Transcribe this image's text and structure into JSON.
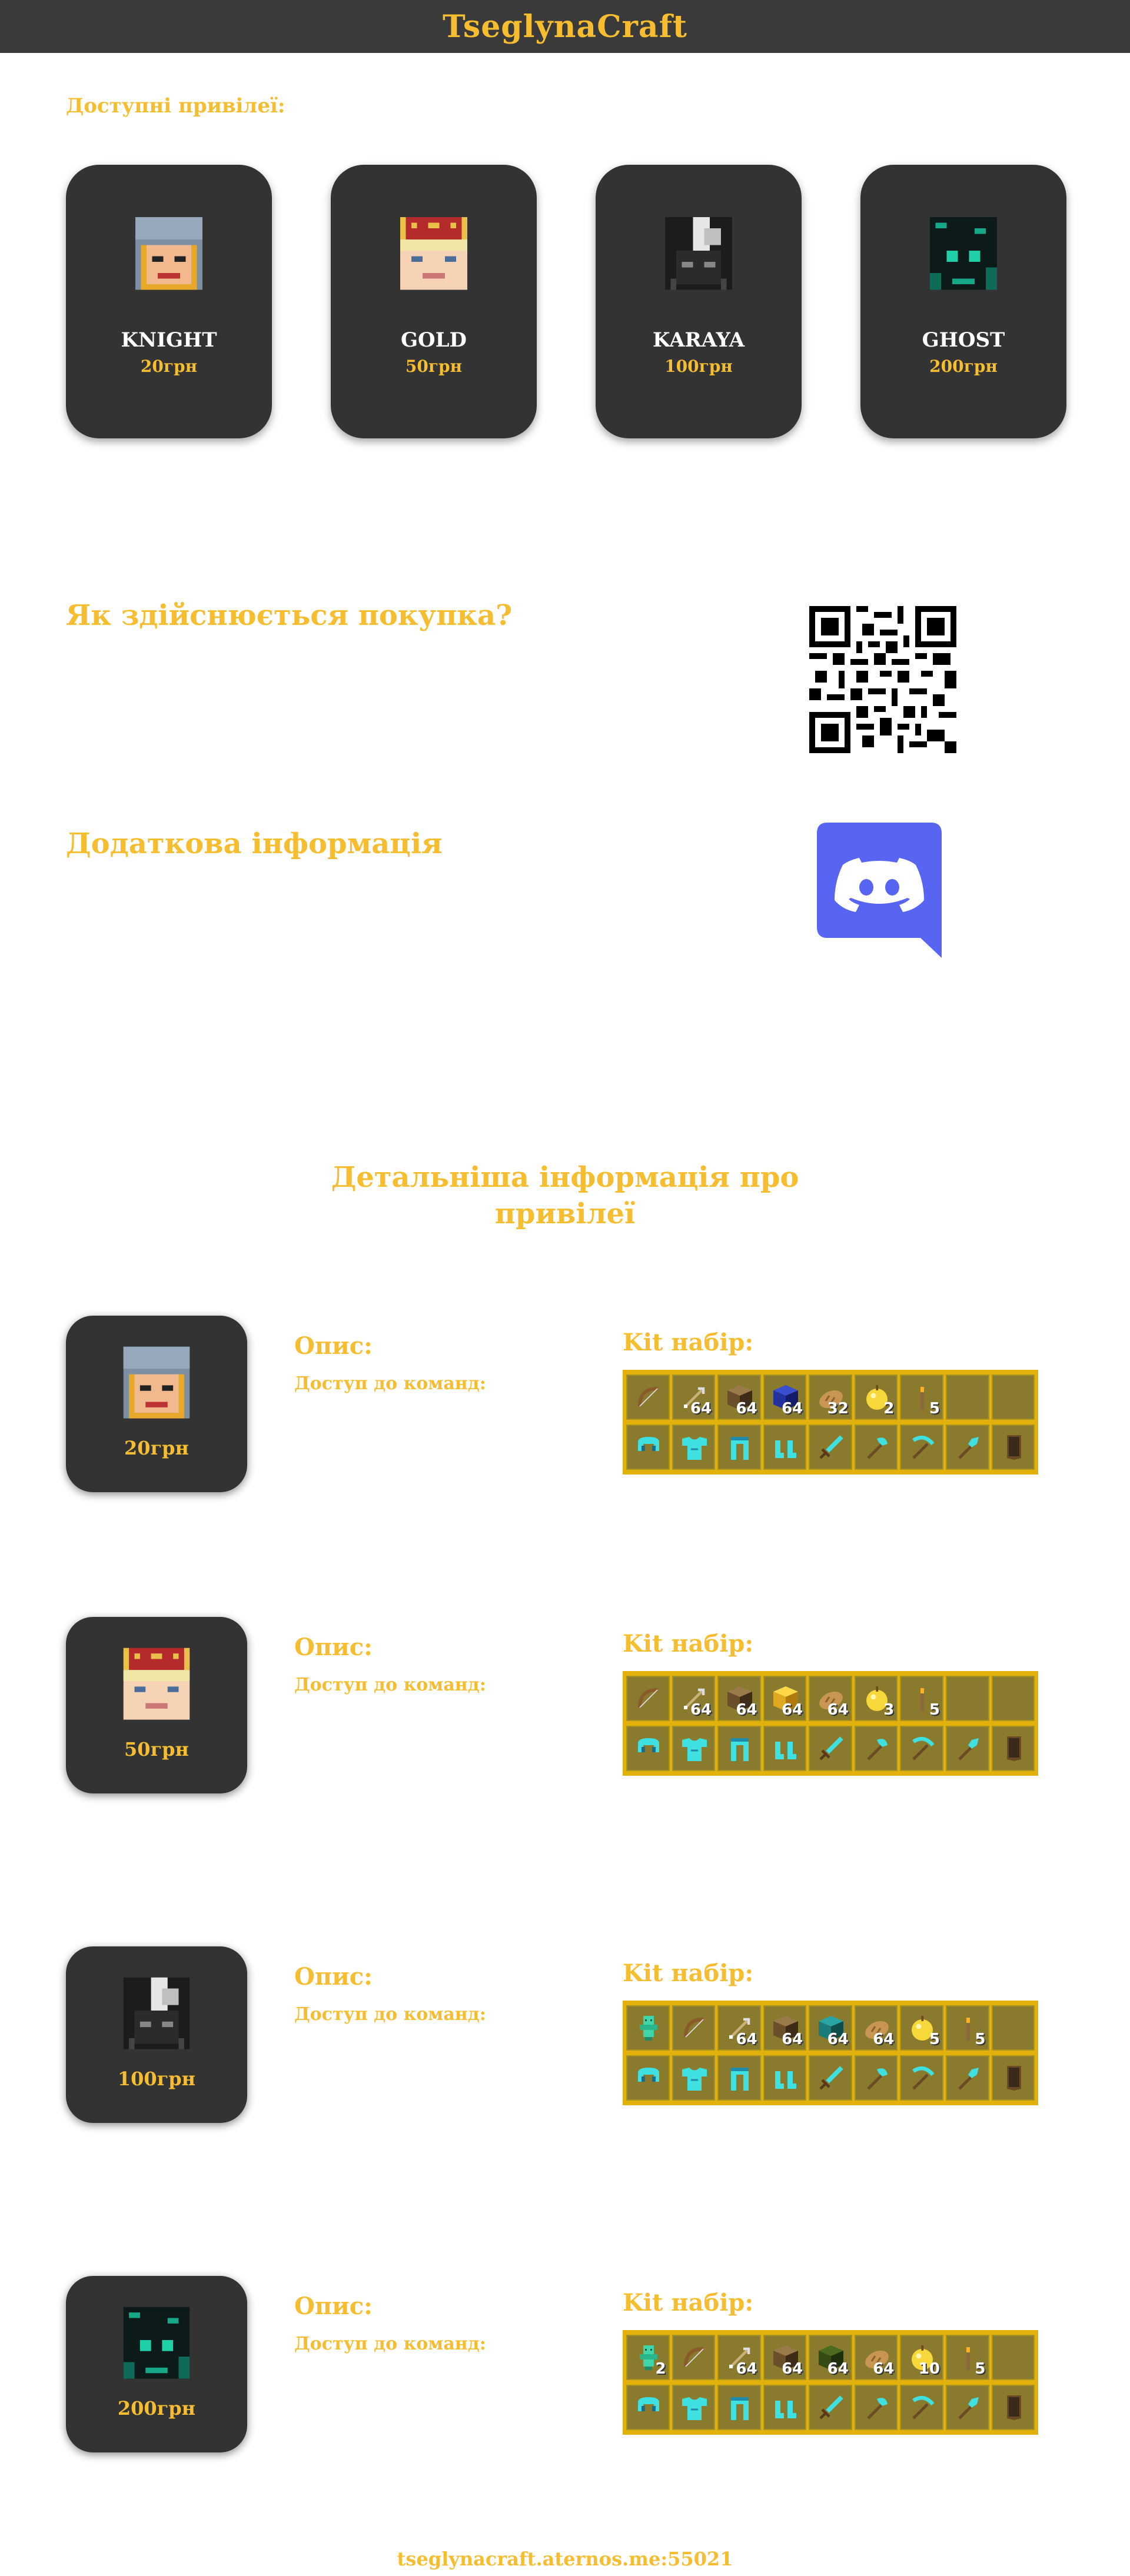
{
  "header": {
    "title": "TseglynaCraft"
  },
  "available": {
    "label": "Доступні привілеї:"
  },
  "privileges": [
    {
      "name": "KNIGHT",
      "price": "20грн",
      "head": "knight"
    },
    {
      "name": "GOLD",
      "price": "50грн",
      "head": "gold"
    },
    {
      "name": "KARAYA",
      "price": "100грн",
      "head": "karaya"
    },
    {
      "name": "GHOST",
      "price": "200грн",
      "head": "ghost"
    }
  ],
  "purchase": {
    "heading": "Як здійснюється покупка?"
  },
  "extra": {
    "heading": "Додаткова інформація"
  },
  "details": {
    "title_line1": "Детальніша інформація про",
    "title_line2": "привілеї",
    "desc_label": "Опис:",
    "cmd_label": "Доступ до команд:",
    "kit_label": "Kit набір:",
    "items": [
      {
        "price": "20грн",
        "row1": [
          {
            "icon": "bow",
            "count": ""
          },
          {
            "icon": "arrow",
            "count": "64"
          },
          {
            "icon": "wood-block",
            "count": "64"
          },
          {
            "icon": "lapis-block",
            "count": "64"
          },
          {
            "icon": "bread",
            "count": "32"
          },
          {
            "icon": "golden-apple",
            "count": "2"
          },
          {
            "icon": "torch",
            "count": "5"
          },
          {
            "icon": "empty",
            "count": ""
          },
          {
            "icon": "empty",
            "count": ""
          }
        ]
      },
      {
        "price": "50грн",
        "row1": [
          {
            "icon": "bow",
            "count": ""
          },
          {
            "icon": "arrow",
            "count": "64"
          },
          {
            "icon": "wood-block",
            "count": "64"
          },
          {
            "icon": "gold-block",
            "count": "64"
          },
          {
            "icon": "bread",
            "count": "64"
          },
          {
            "icon": "golden-apple",
            "count": "3"
          },
          {
            "icon": "torch",
            "count": "5"
          },
          {
            "icon": "empty",
            "count": ""
          },
          {
            "icon": "empty",
            "count": ""
          }
        ]
      },
      {
        "price": "100грн",
        "row1": [
          {
            "icon": "totem",
            "count": ""
          },
          {
            "icon": "bow",
            "count": ""
          },
          {
            "icon": "arrow",
            "count": "64"
          },
          {
            "icon": "wood-block",
            "count": "64"
          },
          {
            "icon": "prismarine-block",
            "count": "64"
          },
          {
            "icon": "bread",
            "count": "64"
          },
          {
            "icon": "golden-apple",
            "count": "5"
          },
          {
            "icon": "torch",
            "count": "5"
          },
          {
            "icon": "empty",
            "count": ""
          }
        ]
      },
      {
        "price": "200грн",
        "row1": [
          {
            "icon": "totem",
            "count": "2"
          },
          {
            "icon": "bow",
            "count": ""
          },
          {
            "icon": "arrow",
            "count": "64"
          },
          {
            "icon": "wood-block",
            "count": "64"
          },
          {
            "icon": "moss-block",
            "count": "64"
          },
          {
            "icon": "bread",
            "count": "64"
          },
          {
            "icon": "golden-apple",
            "count": "10"
          },
          {
            "icon": "torch",
            "count": "5"
          },
          {
            "icon": "empty",
            "count": ""
          }
        ]
      }
    ],
    "row2": [
      "diamond-helmet",
      "diamond-chestplate",
      "diamond-leggings",
      "diamond-boots",
      "diamond-sword",
      "diamond-axe",
      "diamond-pickaxe",
      "diamond-shovel",
      "shield"
    ]
  },
  "footer": {
    "address": "tseglynacraft.aternos.me:55021"
  },
  "colors": {
    "accent": "#f5bd2f",
    "card": "#333333",
    "header": "#3a3a3a",
    "kit": "#e2b10c",
    "discord": "#5865f2"
  }
}
